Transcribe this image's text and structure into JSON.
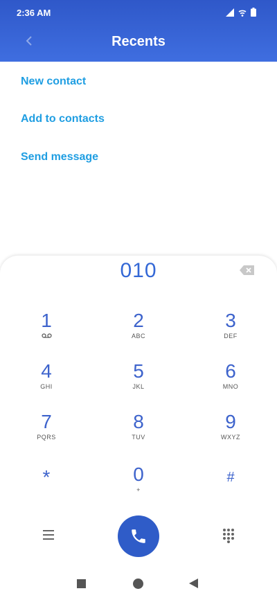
{
  "status_bar": {
    "time": "2:36 AM",
    "icons": [
      "cellular-signal-icon",
      "wifi-icon",
      "battery-icon"
    ]
  },
  "header": {
    "title": "Recents",
    "back_icon": "chevron-left-icon"
  },
  "actions": [
    {
      "label": "New contact"
    },
    {
      "label": "Add to contacts"
    },
    {
      "label": "Send message"
    }
  ],
  "dialer": {
    "number": "010",
    "backspace_icon": "backspace-icon",
    "keys": [
      {
        "digit": "1",
        "letters": ""
      },
      {
        "digit": "2",
        "letters": "ABC"
      },
      {
        "digit": "3",
        "letters": "DEF"
      },
      {
        "digit": "4",
        "letters": "GHI"
      },
      {
        "digit": "5",
        "letters": "JKL"
      },
      {
        "digit": "6",
        "letters": "MNO"
      },
      {
        "digit": "7",
        "letters": "PQRS"
      },
      {
        "digit": "8",
        "letters": "TUV"
      },
      {
        "digit": "9",
        "letters": "WXYZ"
      },
      {
        "digit": "*",
        "letters": ""
      },
      {
        "digit": "0",
        "letters": "+"
      },
      {
        "digit": "#",
        "letters": ""
      }
    ],
    "menu_icon": "hamburger-menu-icon",
    "call_icon": "phone-icon",
    "dialpad_icon": "dialpad-grid-icon"
  },
  "colors": {
    "header": "#3a66d8",
    "accent": "#1f9ee2",
    "digit": "#3d63cc",
    "call_button": "#2f5cc8"
  },
  "navigation_bar": {
    "icons": [
      "square-recents-icon",
      "circle-home-icon",
      "triangle-back-icon"
    ]
  }
}
